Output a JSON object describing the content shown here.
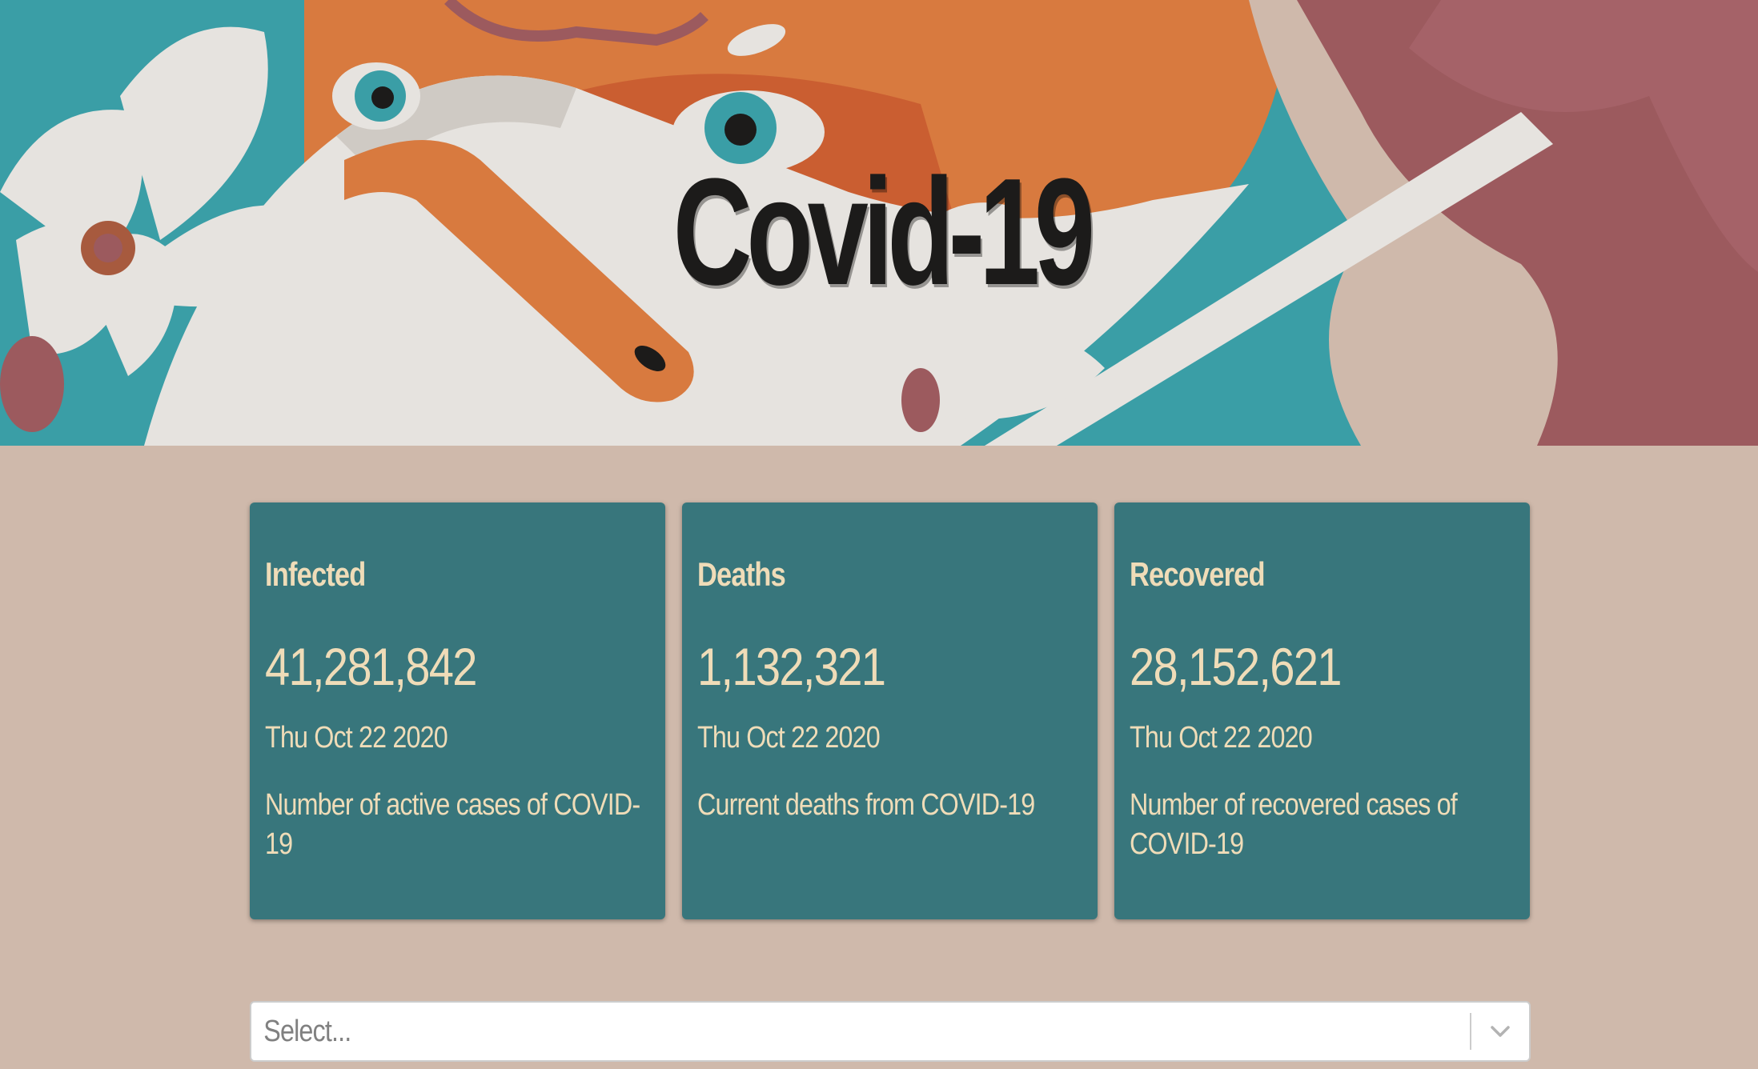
{
  "hero": {
    "title": "Covid-19",
    "image_icon": "hero-illustration"
  },
  "colors": {
    "page_background": "#cfb9ab",
    "card_background": "#38767c",
    "card_text": "#efdcb8",
    "title_text": "#1c1b1a"
  },
  "cards": [
    {
      "title": "Infected",
      "value": "41,281,842",
      "date": "Thu Oct 22 2020",
      "description": "Number of active cases of COVID-19"
    },
    {
      "title": "Deaths",
      "value": "1,132,321",
      "date": "Thu Oct 22 2020",
      "description": "Current deaths from COVID-19"
    },
    {
      "title": "Recovered",
      "value": "28,152,621",
      "date": "Thu Oct 22 2020",
      "description": "Number of recovered cases of COVID-19"
    }
  ],
  "country_select": {
    "placeholder": "Select...",
    "icon": "chevron-down-icon"
  }
}
